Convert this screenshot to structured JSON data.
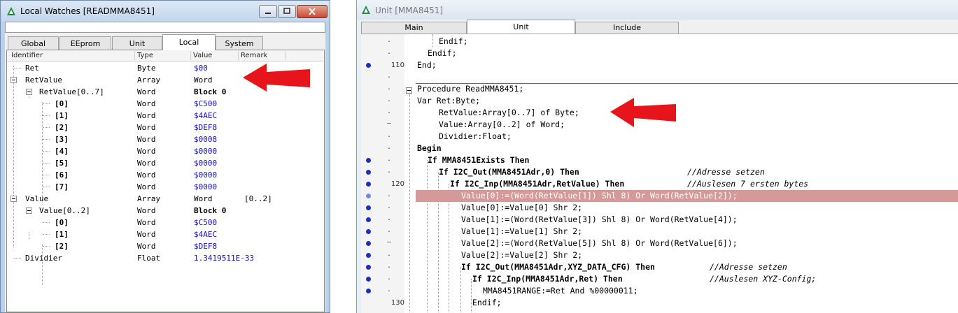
{
  "left_window": {
    "title": "Local Watches [READMMA8451]",
    "tabs": [
      "Global",
      "EEprom",
      "Unit",
      "Local",
      "System"
    ],
    "active_tab": "Local",
    "columns": [
      "Identifier",
      "Type",
      "Value",
      "Remark"
    ],
    "rows": [
      {
        "name": "Ret",
        "type": "Byte",
        "value": "$00",
        "remark": ""
      },
      {
        "name": "RetValue",
        "type": "Array",
        "value": "Word",
        "remark": ""
      },
      {
        "name": "RetValue[0..7]",
        "type": "Word",
        "value": "Block 0",
        "remark": ""
      },
      {
        "name": "[0]",
        "type": "Word",
        "value": "$C500",
        "remark": ""
      },
      {
        "name": "[1]",
        "type": "Word",
        "value": "$4AEC",
        "remark": ""
      },
      {
        "name": "[2]",
        "type": "Word",
        "value": "$DEF8",
        "remark": ""
      },
      {
        "name": "[3]",
        "type": "Word",
        "value": "$0008",
        "remark": ""
      },
      {
        "name": "[4]",
        "type": "Word",
        "value": "$0000",
        "remark": ""
      },
      {
        "name": "[5]",
        "type": "Word",
        "value": "$0000",
        "remark": ""
      },
      {
        "name": "[6]",
        "type": "Word",
        "value": "$0000",
        "remark": ""
      },
      {
        "name": "[7]",
        "type": "Word",
        "value": "$0000",
        "remark": ""
      },
      {
        "name": "Value",
        "type": "Array",
        "value": "Word",
        "remark": "[0..2]"
      },
      {
        "name": "Value[0..2]",
        "type": "Word",
        "value": "Block 0",
        "remark": ""
      },
      {
        "name": "[0]",
        "type": "Word",
        "value": "$C500",
        "remark": ""
      },
      {
        "name": "[1]",
        "type": "Word",
        "value": "$4AEC",
        "remark": ""
      },
      {
        "name": "[2]",
        "type": "Word",
        "value": "$DEF8",
        "remark": ""
      },
      {
        "name": "Dividier",
        "type": "Float",
        "value": "1.3419511E-33",
        "remark": ""
      }
    ]
  },
  "right_window": {
    "title": "Unit [MMA8451]",
    "tabs": [
      "Main",
      "Unit",
      "Include"
    ],
    "active_tab": "Unit",
    "lines": [
      {
        "mark": ".",
        "num": "",
        "code": "Endif;",
        "bp": false
      },
      {
        "mark": ".",
        "num": "",
        "code": "Endif;",
        "bp": false
      },
      {
        "mark": "",
        "num": "110",
        "code": "End;",
        "bp": true
      },
      {
        "mark": ".",
        "num": "",
        "code": "",
        "bp": false
      },
      {
        "mark": ".",
        "num": "",
        "code": "Procedure ReadMMA8451;",
        "bp": false
      },
      {
        "mark": ".",
        "num": "",
        "code": "Var Ret:Byte;",
        "bp": false
      },
      {
        "mark": ".",
        "num": "",
        "code": "RetValue:Array[0..7] of Byte;",
        "bp": false
      },
      {
        "mark": "–",
        "num": "",
        "code": "Value:Array[0..2] of Word;",
        "bp": false
      },
      {
        "mark": ".",
        "num": "",
        "code": "Dividier:Float;",
        "bp": false
      },
      {
        "mark": ".",
        "num": "",
        "code": "Begin",
        "bp": false
      },
      {
        "mark": ".",
        "num": "",
        "code": "If MMA8451Exists Then",
        "bp": true
      },
      {
        "mark": ".",
        "num": "",
        "code": "If I2C_Out(MMA8451Adr,0) Then",
        "comment": "//Adresse setzen",
        "bp": true
      },
      {
        "mark": "",
        "num": "120",
        "code": "If I2C_Inp(MMA8451Adr,RetValue) Then",
        "comment": "//Auslesen 7 ersten bytes",
        "bp": true
      },
      {
        "mark": ".",
        "num": "",
        "code": "Value[0]:=(Word(RetValue[1]) Shl 8) Or Word(RetValue[2]);",
        "bp": true,
        "highlight": true
      },
      {
        "mark": ".",
        "num": "",
        "code": "Value[0]:=Value[0] Shr 2;",
        "bp": true
      },
      {
        "mark": ".",
        "num": "",
        "code": "Value[1]:=(Word(RetValue[3]) Shl 8) Or Word(RetValue[4]);",
        "bp": true
      },
      {
        "mark": ".",
        "num": "",
        "code": "Value[1]:=Value[1] Shr 2;",
        "bp": true
      },
      {
        "mark": "–",
        "num": "",
        "code": "Value[2]:=(Word(RetValue[5]) Shl 8) Or Word(RetValue[6]);",
        "bp": true
      },
      {
        "mark": ".",
        "num": "",
        "code": "Value[2]:=Value[2] Shr 2;",
        "bp": true
      },
      {
        "mark": ".",
        "num": "",
        "code": "If I2C_Out(MMA8451Adr,XYZ_DATA_CFG) Then",
        "comment": "//Adresse setzen",
        "bp": true
      },
      {
        "mark": ".",
        "num": "",
        "code": "If I2C_Inp(MMA8451Adr,Ret) Then",
        "comment": "//Auslesen XYZ-Config;",
        "bp": true
      },
      {
        "mark": ".",
        "num": "",
        "code": "MMA8451RANGE:=Ret And %00000011;",
        "bp": true
      },
      {
        "mark": "",
        "num": "130",
        "code": "Endif;",
        "bp": false
      }
    ]
  },
  "colors": {
    "arrow": "#e8141c",
    "highlight": "#d49a9a",
    "breakpoint": "#1a2fc4",
    "value_blue": "#1010c8",
    "comment": "#1c7a1c"
  }
}
